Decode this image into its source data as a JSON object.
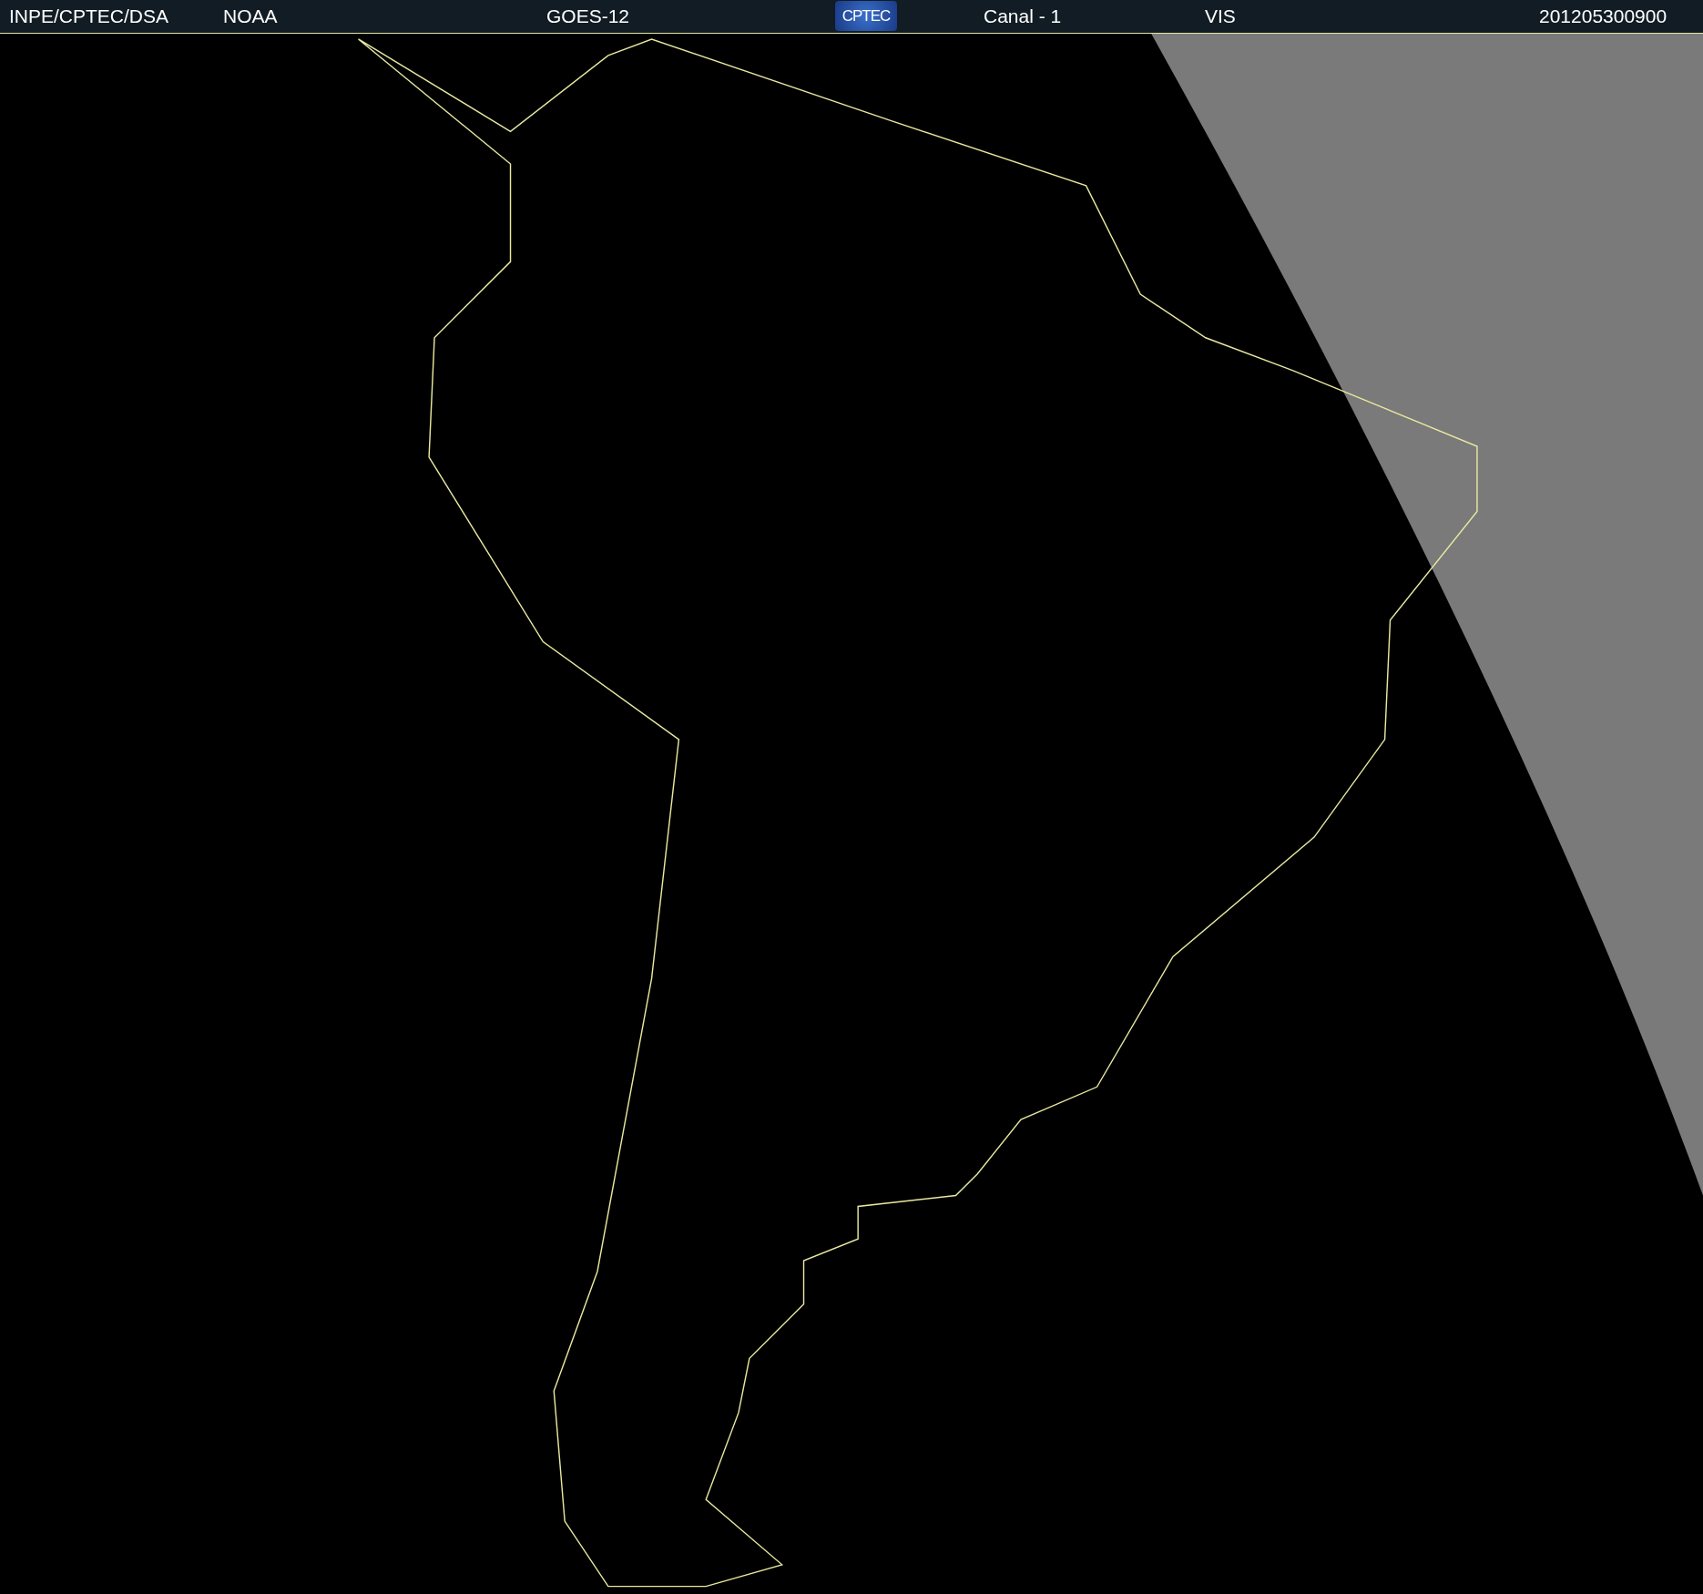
{
  "header": {
    "items": [
      {
        "kind": "text",
        "text": "INPE/CPTEC/DSA"
      },
      {
        "kind": "text",
        "text": "NOAA"
      },
      {
        "kind": "text",
        "text": "GOES-12"
      },
      {
        "kind": "logo",
        "text": "CPTEC"
      },
      {
        "kind": "text",
        "text": "Canal - 1"
      },
      {
        "kind": "text",
        "text": "VIS"
      },
      {
        "kind": "text",
        "text": "201205300900"
      }
    ]
  }
}
